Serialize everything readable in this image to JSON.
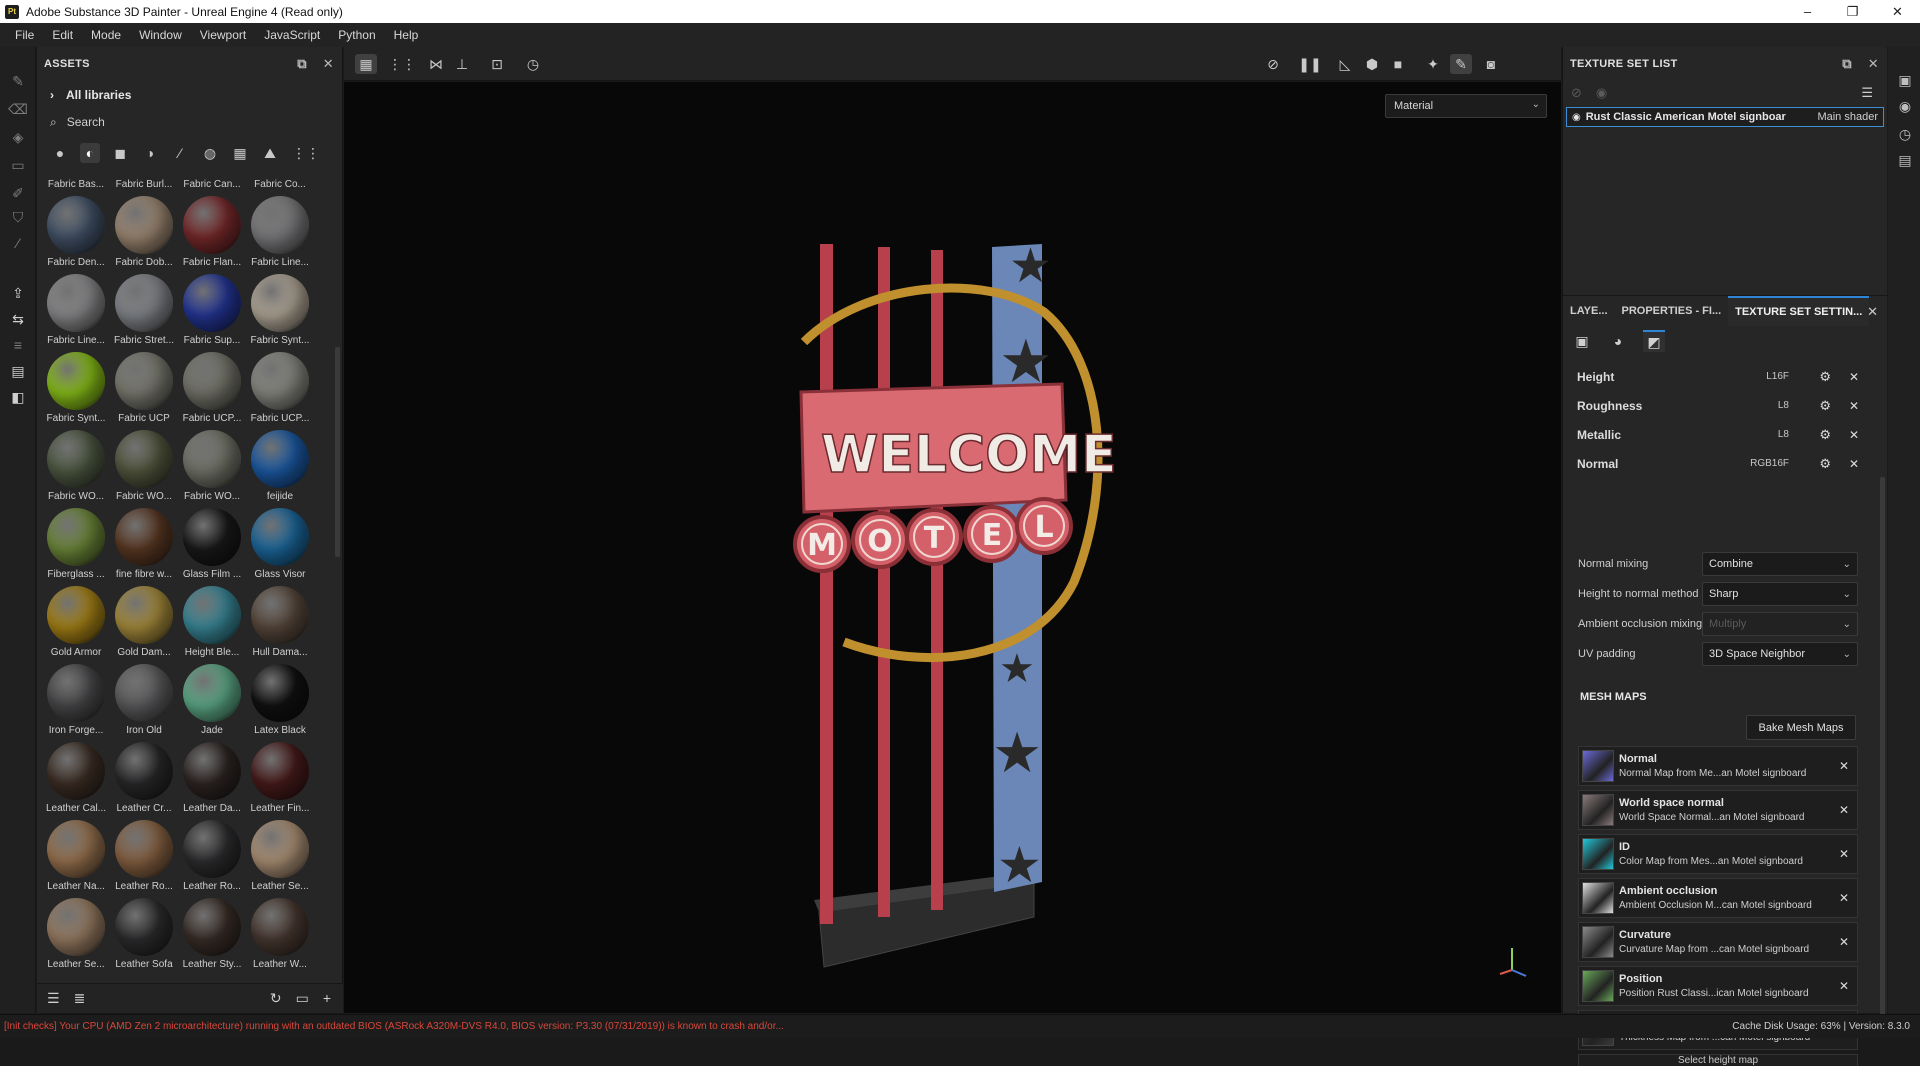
{
  "window": {
    "icon_text": "Pt",
    "title": "Adobe Substance 3D Painter - Unreal Engine 4 (Read only)",
    "controls": [
      "–",
      "❐",
      "✕"
    ]
  },
  "menu": [
    "File",
    "Edit",
    "Mode",
    "Window",
    "Viewport",
    "JavaScript",
    "Python",
    "Help"
  ],
  "assets": {
    "header": "ASSETS",
    "library": "All libraries",
    "search_placeholder": "Search",
    "top_labels": [
      "Fabric Bas...",
      "Fabric Burl...",
      "Fabric Can...",
      "Fabric Co..."
    ],
    "items": [
      {
        "label": "Fabric Den...",
        "color": "#44546a"
      },
      {
        "label": "Fabric Dob...",
        "color": "#a08a74"
      },
      {
        "label": "Fabric Flan...",
        "color": "#7a2a2c"
      },
      {
        "label": "Fabric Line...",
        "color": "#7e7e80"
      },
      {
        "label": "Fabric Line...",
        "color": "#8c8c8e"
      },
      {
        "label": "Fabric Stret...",
        "color": "#85888d"
      },
      {
        "label": "Fabric Sup...",
        "color": "#25379a"
      },
      {
        "label": "Fabric Synt...",
        "color": "#b5aa9a"
      },
      {
        "label": "Fabric Synt...",
        "color": "#8bc219"
      },
      {
        "label": "Fabric UCP",
        "color": "#7c7c72"
      },
      {
        "label": "Fabric UCP...",
        "color": "#76766c"
      },
      {
        "label": "Fabric UCP...",
        "color": "#8a8a84"
      },
      {
        "label": "Fabric WO...",
        "color": "#505a44"
      },
      {
        "label": "Fabric WO...",
        "color": "#54583f"
      },
      {
        "label": "Fabric WO...",
        "color": "#74766a"
      },
      {
        "label": "feijide",
        "color": "#1c5ca8"
      },
      {
        "label": "Fiberglass ...",
        "color": "#6e8a3a"
      },
      {
        "label": "fine fibre w...",
        "color": "#5c3a24"
      },
      {
        "label": "Glass Film ...",
        "color": "#1a1a1a"
      },
      {
        "label": "Glass Visor",
        "color": "#1c6aa0"
      },
      {
        "label": "Gold Armor",
        "color": "#a88416"
      },
      {
        "label": "Gold Dam...",
        "color": "#a98e3c"
      },
      {
        "label": "Height Ble...",
        "color": "#3a8a9a"
      },
      {
        "label": "Hull Dama...",
        "color": "#5a4a3e"
      },
      {
        "label": "Iron Forge...",
        "color": "#4a4a4c"
      },
      {
        "label": "Iron Old",
        "color": "#5e5e60"
      },
      {
        "label": "Jade",
        "color": "#5fae8a"
      },
      {
        "label": "Latex Black",
        "color": "#121212"
      },
      {
        "label": "Leather Cal...",
        "color": "#3e2f26"
      },
      {
        "label": "Leather Cr...",
        "color": "#2a2a2c"
      },
      {
        "label": "Leather Da...",
        "color": "#2e2624"
      },
      {
        "label": "Leather Fin...",
        "color": "#4a1c1c"
      },
      {
        "label": "Leather Na...",
        "color": "#9a7450"
      },
      {
        "label": "Leather Ro...",
        "color": "#8a6444"
      },
      {
        "label": "Leather Ro...",
        "color": "#2e2e30"
      },
      {
        "label": "Leather Se...",
        "color": "#b09478"
      },
      {
        "label": "Leather Se...",
        "color": "#9a7e64"
      },
      {
        "label": "Leather Sofa",
        "color": "#2e2e30"
      },
      {
        "label": "Leather Sty...",
        "color": "#3a2e28"
      },
      {
        "label": "Leather W...",
        "color": "#4a3a32"
      }
    ]
  },
  "viewport": {
    "material_select": "Material",
    "sign_text_top": "WELCOME",
    "sign_letters": [
      "M",
      "O",
      "T",
      "E",
      "L"
    ]
  },
  "texture_set_list": {
    "header": "TEXTURE SET LIST",
    "row_name": "Rust Classic American Motel signboard",
    "row_shader": "Main shader"
  },
  "tabs": [
    "LAYE...",
    "PROPERTIES - FI...",
    "TEXTURE SET SETTIN..."
  ],
  "channels": [
    {
      "name": "Height",
      "format": "L16F"
    },
    {
      "name": "Roughness",
      "format": "L8"
    },
    {
      "name": "Metallic",
      "format": "L8"
    },
    {
      "name": "Normal",
      "format": "RGB16F"
    }
  ],
  "properties": [
    {
      "label": "Normal mixing",
      "value": "Combine",
      "disabled": false
    },
    {
      "label": "Height to normal method",
      "value": "Sharp",
      "disabled": false
    },
    {
      "label": "Ambient occlusion mixing",
      "value": "Multiply",
      "disabled": true
    },
    {
      "label": "UV padding",
      "value": "3D Space Neighbor",
      "disabled": false
    }
  ],
  "mesh_maps": {
    "title": "MESH MAPS",
    "bake_button": "Bake Mesh Maps",
    "items": [
      {
        "name": "Normal",
        "desc": "Normal Map from Me...an Motel signboard",
        "color": "#6a6ad8"
      },
      {
        "name": "World space normal",
        "desc": "World Space Normal...an Motel signboard",
        "color": "#8a7a7a"
      },
      {
        "name": "ID",
        "desc": "Color Map from Mes...an Motel signboard",
        "color": "#22c8d8"
      },
      {
        "name": "Ambient occlusion",
        "desc": "Ambient Occlusion M...can Motel signboard",
        "color": "#e0e0e0"
      },
      {
        "name": "Curvature",
        "desc": "Curvature Map from ...can Motel signboard",
        "color": "#8a8a8a"
      },
      {
        "name": "Position",
        "desc": "Position Rust Classi...ican Motel signboard",
        "color": "#6aa85a"
      },
      {
        "name": "Thickness",
        "desc": "Thickness Map from ...can Motel signboard",
        "color": "#3a3a3a"
      }
    ],
    "height_map": "Select height map"
  },
  "status": {
    "error": "[Init checks] Your CPU (AMD Zen 2 microarchitecture) running with an outdated BIOS (ASRock A320M-DVS R4.0, BIOS version: P3.30 (07/31/2019)) is known to crash and/or...",
    "right": "Cache Disk Usage:   63%  |  Version: 8.3.0"
  }
}
